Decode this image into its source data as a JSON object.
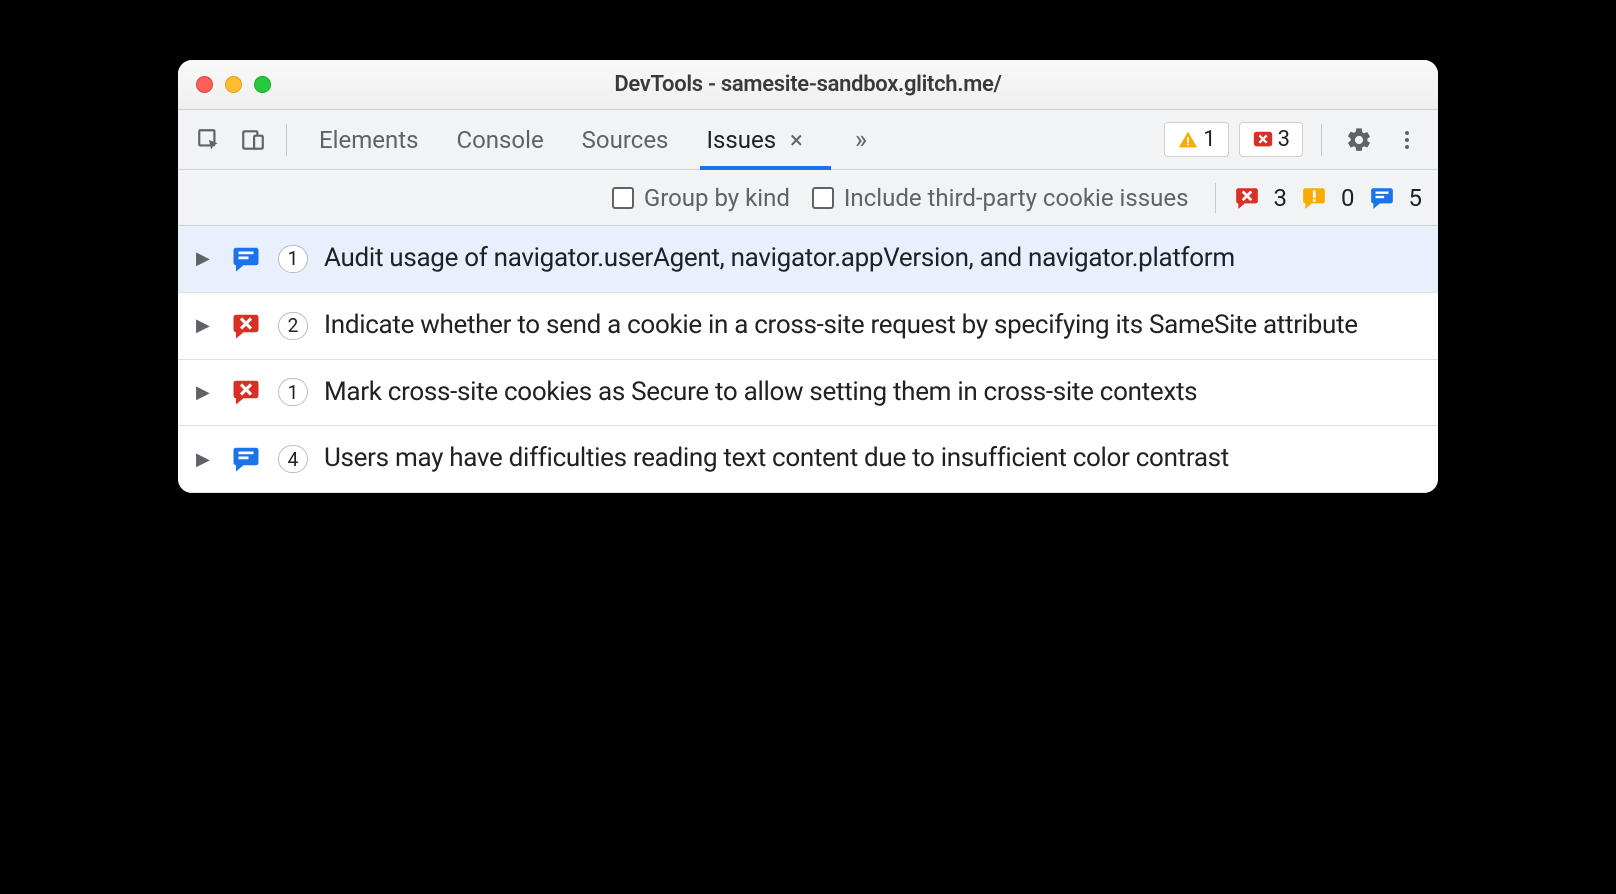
{
  "window": {
    "title": "DevTools - samesite-sandbox.glitch.me/"
  },
  "toolbar": {
    "tabs": [
      "Elements",
      "Console",
      "Sources",
      "Issues"
    ],
    "active_tab_index": 3,
    "warnings_count": "1",
    "errors_count": "3"
  },
  "options": {
    "group_by_kind_label": "Group by kind",
    "include_third_party_label": "Include third-party cookie issues",
    "error_count": "3",
    "warning_count": "0",
    "info_count": "5"
  },
  "issues": [
    {
      "type": "info",
      "count": "1",
      "text": "Audit usage of navigator.userAgent, navigator.appVersion, and navigator.platform",
      "selected": true
    },
    {
      "type": "error",
      "count": "2",
      "text": "Indicate whether to send a cookie in a cross-site request by specifying its SameSite attribute",
      "selected": false
    },
    {
      "type": "error",
      "count": "1",
      "text": "Mark cross-site cookies as Secure to allow setting them in cross-site contexts",
      "selected": false
    },
    {
      "type": "info",
      "count": "4",
      "text": "Users may have difficulties reading text content due to insufficient color contrast",
      "selected": false
    }
  ]
}
